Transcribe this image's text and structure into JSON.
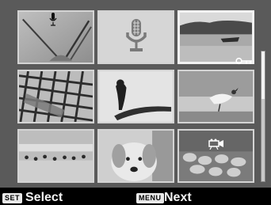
{
  "bottom_bar": {
    "select_key": "SET",
    "select_label": "Select",
    "menu_key": "MENU",
    "next_label": "Next"
  },
  "thumbnails": [
    {
      "subject": "crossed sticks",
      "badge_icon": "microphone-icon"
    },
    {
      "subject": "audio file",
      "badge_icon": "microphone-large-icon"
    },
    {
      "subject": "lake with boat",
      "badge_icon": "key-protect-icon",
      "selected": true
    },
    {
      "subject": "grid mesh"
    },
    {
      "subject": "bird on branch"
    },
    {
      "subject": "bird standing on ground"
    },
    {
      "subject": "birds on beach"
    },
    {
      "subject": "dog portrait"
    },
    {
      "subject": "sheep in field",
      "badge_icon": "movie-icon"
    }
  ]
}
